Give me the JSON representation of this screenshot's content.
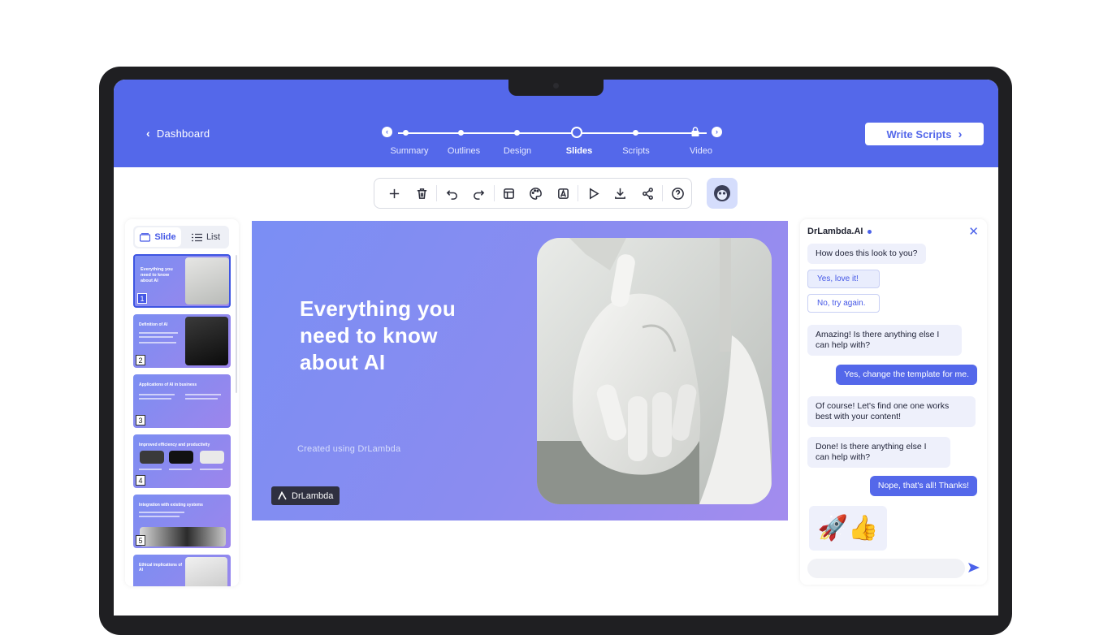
{
  "header": {
    "back_label": "Dashboard",
    "steps": [
      {
        "label": "Summary",
        "state": "done"
      },
      {
        "label": "Outlines",
        "state": "done"
      },
      {
        "label": "Design",
        "state": "done"
      },
      {
        "label": "Slides",
        "state": "active"
      },
      {
        "label": "Scripts",
        "state": "todo"
      },
      {
        "label": "Video",
        "state": "locked"
      }
    ],
    "write_scripts_label": "Write Scripts"
  },
  "toolbar": {
    "buttons": [
      "add-icon",
      "trash-icon",
      "undo-icon",
      "redo-icon",
      "layout-icon",
      "palette-icon",
      "text-style-icon",
      "play-icon",
      "download-icon",
      "share-icon",
      "help-icon"
    ]
  },
  "sidebar": {
    "view_tabs": [
      {
        "label": "Slide",
        "selected": true
      },
      {
        "label": "List",
        "selected": false
      }
    ],
    "thumbnails": [
      {
        "number": "1",
        "title": "Everything you need to know about AI"
      },
      {
        "number": "2",
        "title": "Definition of AI"
      },
      {
        "number": "3",
        "title": "Applications of AI in business"
      },
      {
        "number": "4",
        "title": "Improved efficiency and productivity"
      },
      {
        "number": "5",
        "title": "Integration with existing systems"
      },
      {
        "number": "6",
        "title": "Ethical implications of AI"
      }
    ]
  },
  "slide": {
    "title": "Everything you need to know about AI",
    "subtitle": "Created using DrLambda",
    "brand": "DrLambda"
  },
  "chat": {
    "title": "DrLambda.AI",
    "messages": [
      {
        "role": "bot",
        "text": "How does this look to you?"
      },
      {
        "role": "option",
        "text": "Yes, love it!"
      },
      {
        "role": "option",
        "text": "No, try again."
      },
      {
        "role": "bot",
        "text": "Amazing! Is there anything else I can help with?"
      },
      {
        "role": "user",
        "text": "Yes, change the template for me."
      },
      {
        "role": "bot",
        "text": "Of course! Let's find one one works best with your content!"
      },
      {
        "role": "bot",
        "text": "Done! Is there anything else I can help with?"
      },
      {
        "role": "user",
        "text": "Nope, that's all! Thanks!"
      }
    ],
    "emoji": "🚀👍",
    "input_value": ""
  },
  "colors": {
    "accent": "#5468ea",
    "slide_gradient_start": "#7a8ef4",
    "slide_gradient_end": "#a38cee"
  }
}
